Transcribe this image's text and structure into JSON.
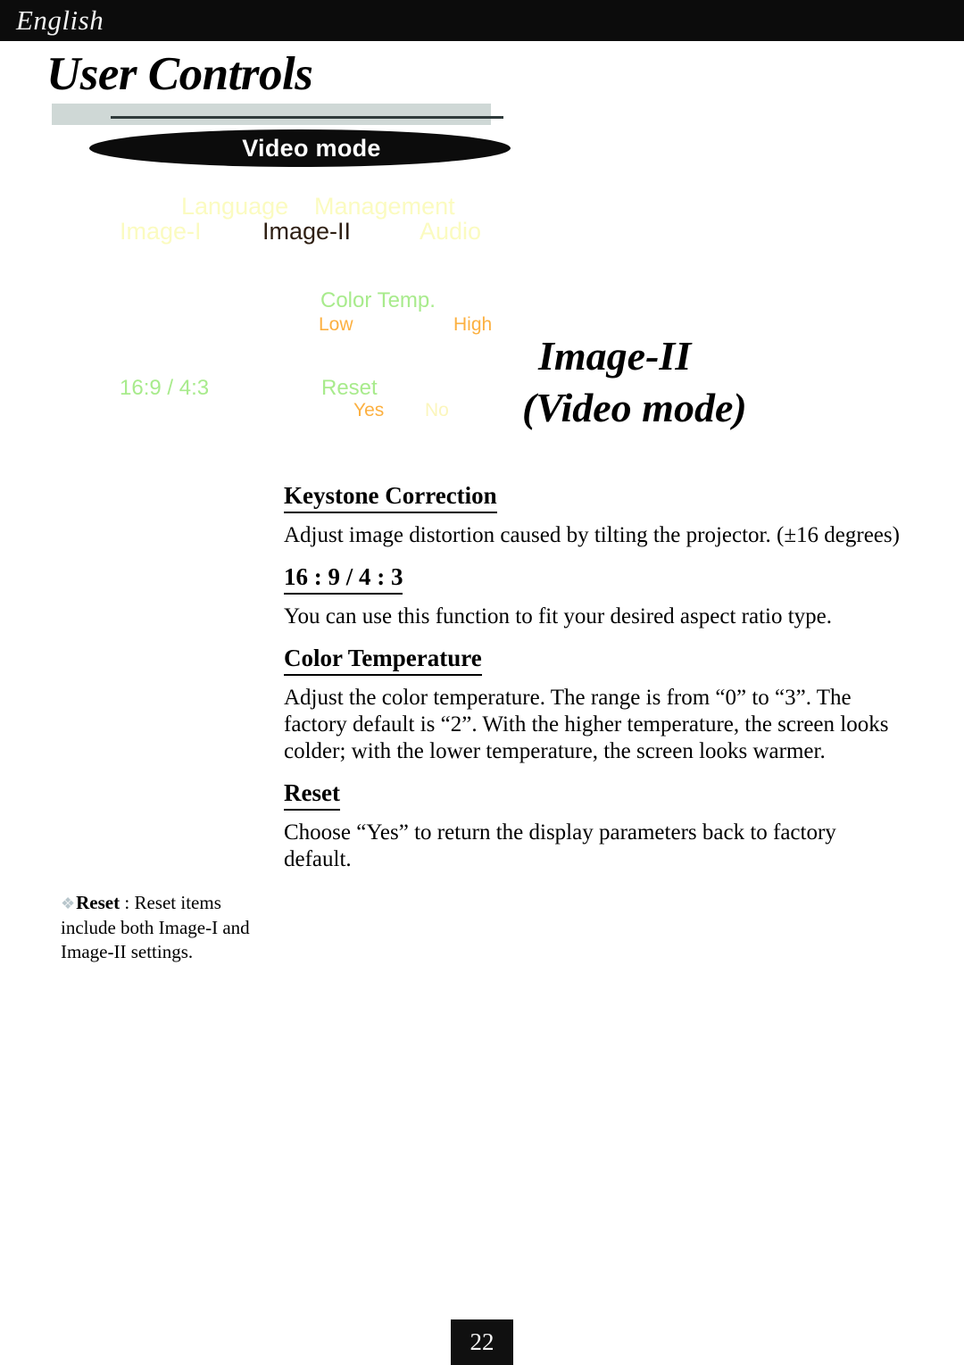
{
  "header": {
    "language_label": "English"
  },
  "chapter": {
    "title": "User Controls",
    "banner_label": "Video mode"
  },
  "osd": {
    "tabs_top": [
      {
        "label": "Language",
        "color": "#fbfbc0",
        "active": false
      },
      {
        "label": "Management",
        "color": "#fbfbc0",
        "active": false
      }
    ],
    "tabs_bottom": [
      {
        "label": "Image-I",
        "color": "#fbfbc0",
        "active": false
      },
      {
        "label": "Image-II",
        "color": "#2e1f13",
        "active": true
      },
      {
        "label": "Audio",
        "color": "#fbfbc0",
        "active": false
      }
    ],
    "groups": {
      "color_temp_label": "Color Temp.",
      "color_temp_low": "Low",
      "color_temp_high": "High",
      "aspect_label": "16:9 / 4:3",
      "reset_label": "Reset",
      "reset_yes": "Yes",
      "reset_no": "No"
    },
    "colors": {
      "tab_inactive": "#fbfbc0",
      "tab_active": "#2e1f13",
      "group_label": "#a8eb8c",
      "option_highlight": "#fcb040",
      "option_dim": "#fbf6bd"
    }
  },
  "section": {
    "title_line1": "Image-II",
    "title_line2": "(Video mode)"
  },
  "content": {
    "items": [
      {
        "heading": "Keystone Correction",
        "body": "Adjust image distortion caused by tilting the projector. (±16 degrees)"
      },
      {
        "heading": "16 : 9 / 4 : 3",
        "body": "You can use this function to fit your desired aspect ratio type."
      },
      {
        "heading": "Color Temperature",
        "body": "Adjust the color temperature. The range is from “0” to “3”. The factory default is “2”.  With the higher temperature, the screen looks colder; with the lower temperature, the screen looks warmer."
      },
      {
        "heading": "Reset",
        "body": "Choose “Yes” to return the display parameters back to factory default."
      }
    ]
  },
  "note": {
    "bullet": "❖",
    "lead": "Reset",
    "text": " : Reset items include both Image-I and Image-II settings."
  },
  "footer": {
    "page_number": "22"
  }
}
